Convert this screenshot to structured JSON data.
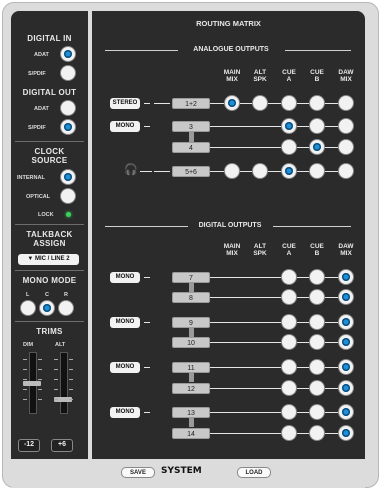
{
  "left": {
    "digital_in": {
      "title": "DIGITAL IN",
      "options": [
        {
          "label": "ADAT",
          "on": true
        },
        {
          "label": "S/PDIF",
          "on": false
        }
      ]
    },
    "digital_out": {
      "title": "DIGITAL OUT",
      "options": [
        {
          "label": "ADAT",
          "on": false
        },
        {
          "label": "S/PDIF",
          "on": true
        }
      ]
    },
    "clock": {
      "title1": "CLOCK",
      "title2": "SOURCE",
      "options": [
        {
          "label": "INTERNAL",
          "on": true
        },
        {
          "label": "OPTICAL",
          "on": false
        }
      ],
      "lock_label": "LOCK"
    },
    "talkback": {
      "title1": "TALKBACK",
      "title2": "ASSIGN",
      "value": "▼ MIC / LINE 2"
    },
    "mono_mode": {
      "title": "MONO MODE",
      "labels": [
        "L",
        "C",
        "R"
      ],
      "selected": "C"
    },
    "trims": {
      "title": "TRIMS",
      "labels": [
        "DIM",
        "ALT"
      ],
      "buttons": [
        "-12",
        "+6"
      ]
    }
  },
  "main": {
    "title": "ROUTING MATRIX",
    "analogue_title": "ANALOGUE OUTPUTS",
    "digital_title": "DIGITAL OUTPUTS",
    "columns": [
      [
        "MAIN",
        "MIX"
      ],
      [
        "ALT",
        "SPK"
      ],
      [
        "CUE",
        "A"
      ],
      [
        "CUE",
        "B"
      ],
      [
        "DAW",
        "MIX"
      ]
    ],
    "analogue_rows": [
      {
        "mode": "STEREO",
        "channel": "1+2",
        "row_type": "stereo",
        "selected": 0
      },
      {
        "mode": "MONO",
        "channel": "3",
        "row_type": "mono",
        "selected": 2
      },
      {
        "mode": "",
        "channel": "4",
        "row_type": "mono",
        "selected": 3
      },
      {
        "mode": "headphones",
        "channel": "5+6",
        "row_type": "stereo",
        "selected": 2
      }
    ],
    "digital_rows": [
      {
        "mode": "MONO",
        "channel": "7",
        "selected": 4
      },
      {
        "mode": "",
        "channel": "8",
        "selected": 4
      },
      {
        "mode": "MONO",
        "channel": "9",
        "selected": 4
      },
      {
        "mode": "",
        "channel": "10",
        "selected": 4
      },
      {
        "mode": "MONO",
        "channel": "11",
        "selected": 4
      },
      {
        "mode": "",
        "channel": "12",
        "selected": 4
      },
      {
        "mode": "MONO",
        "channel": "13",
        "selected": 4
      },
      {
        "mode": "",
        "channel": "14",
        "selected": 4
      }
    ]
  },
  "footer": {
    "save": "SAVE",
    "system": "SYSTEM",
    "load": "LOAD"
  },
  "colors": {
    "accent": "#1f8fd6",
    "panel": "#2b2b2b",
    "lock": "#39d45a"
  }
}
